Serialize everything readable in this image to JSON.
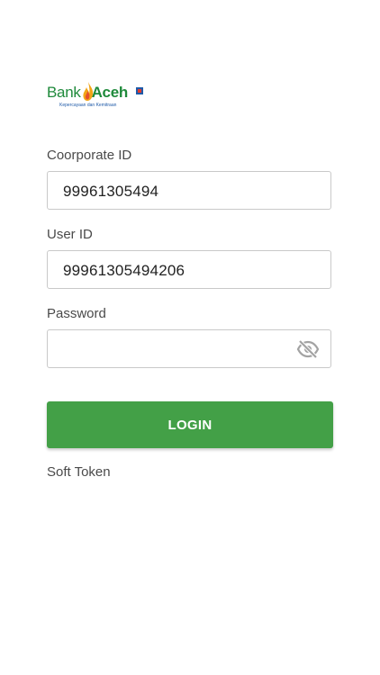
{
  "logo": {
    "name_regular": "Bank",
    "name_bold": "Aceh",
    "tagline": "Kepercayaan dan Kemitraan"
  },
  "form": {
    "corporate_id": {
      "label": "Coorporate ID",
      "value": "99961305494"
    },
    "user_id": {
      "label": "User ID",
      "value": "99961305494206"
    },
    "password": {
      "label": "Password",
      "value": "",
      "visibility_icon": "eye-off-icon"
    },
    "login_label": "LOGIN",
    "soft_token_label": "Soft Token"
  },
  "colors": {
    "primary_button": "#43a047",
    "brand_green": "#1f8a3b"
  }
}
